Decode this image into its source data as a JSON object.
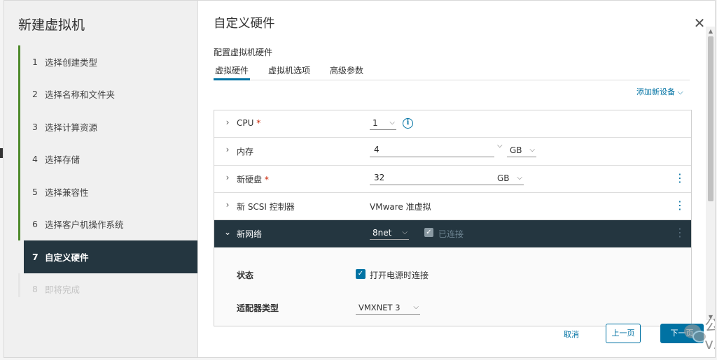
{
  "wizard": {
    "title": "新建虚拟机"
  },
  "steps": [
    {
      "num": "1",
      "label": "选择创建类型"
    },
    {
      "num": "2",
      "label": "选择名称和文件夹"
    },
    {
      "num": "3",
      "label": "选择计算资源"
    },
    {
      "num": "4",
      "label": "选择存储"
    },
    {
      "num": "5",
      "label": "选择兼容性"
    },
    {
      "num": "6",
      "label": "选择客户机操作系统"
    },
    {
      "num": "7",
      "label": "自定义硬件"
    },
    {
      "num": "8",
      "label": "即将完成"
    }
  ],
  "page": {
    "title": "自定义硬件",
    "subtitle": "配置虚拟机硬件",
    "tabs": [
      "虚拟硬件",
      "虚拟机选项",
      "高级参数"
    ],
    "add_device": "添加新设备"
  },
  "hardware": {
    "cpu": {
      "label": "CPU",
      "required": "*",
      "value": "1"
    },
    "memory": {
      "label": "内存",
      "value": "4",
      "unit": "GB"
    },
    "disk": {
      "label": "新硬盘",
      "required": "*",
      "value": "32",
      "unit": "GB"
    },
    "scsi": {
      "label": "新 SCSI 控制器",
      "value": "VMware 准虚拟"
    },
    "network": {
      "label": "新网络",
      "value": "8net",
      "connected_label": "已连接",
      "status_label": "状态",
      "power_on_label": "打开电源时连接",
      "adapter_label": "适配器类型",
      "adapter_value": "VMXNET 3"
    }
  },
  "footer": {
    "cancel": "取消",
    "prev": "上一页",
    "next": "下一页"
  },
  "watermark": {
    "text": "公众号 · vArchitect"
  },
  "colors": {
    "accent": "#0072a3",
    "active_step": "#243640",
    "done_bar": "#4e8a2c"
  }
}
